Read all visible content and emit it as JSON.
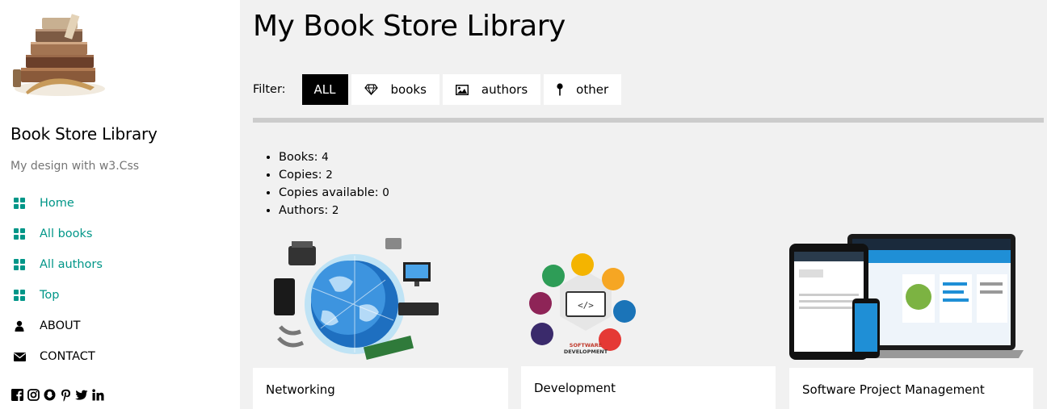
{
  "sidebar": {
    "title": "Book Store Library",
    "subtitle": "My design with w3.Css",
    "nav": [
      {
        "label": "Home",
        "icon": "grid-icon"
      },
      {
        "label": "All books",
        "icon": "grid-icon"
      },
      {
        "label": "All authors",
        "icon": "grid-icon"
      },
      {
        "label": "Top",
        "icon": "grid-icon"
      },
      {
        "label": "ABOUT",
        "icon": "user-icon"
      },
      {
        "label": "CONTACT",
        "icon": "envelope-icon"
      }
    ],
    "social": [
      "facebook-icon",
      "instagram-icon",
      "snapchat-icon",
      "pinterest-icon",
      "twitter-icon",
      "linkedin-icon"
    ]
  },
  "main": {
    "title": "My Book Store Library",
    "filter": {
      "label": "Filter:",
      "buttons": [
        {
          "label": "ALL",
          "icon": ""
        },
        {
          "label": "books",
          "icon": "diamond-icon"
        },
        {
          "label": "authors",
          "icon": "photo-icon"
        },
        {
          "label": "other",
          "icon": "map-pin-icon"
        }
      ]
    },
    "stats": [
      {
        "label": "Books:",
        "value": "4"
      },
      {
        "label": "Copies:",
        "value": "2"
      },
      {
        "label": "Copies available:",
        "value": "0"
      },
      {
        "label": "Authors:",
        "value": "2"
      }
    ],
    "cards": [
      {
        "title": "Networking"
      },
      {
        "title": "Development"
      },
      {
        "title": "Software Project Management"
      }
    ]
  },
  "colors": {
    "accent": "#009688",
    "main_bg": "#f1f1f1",
    "active_filter_bg": "#000000",
    "divider": "#cccccc"
  }
}
